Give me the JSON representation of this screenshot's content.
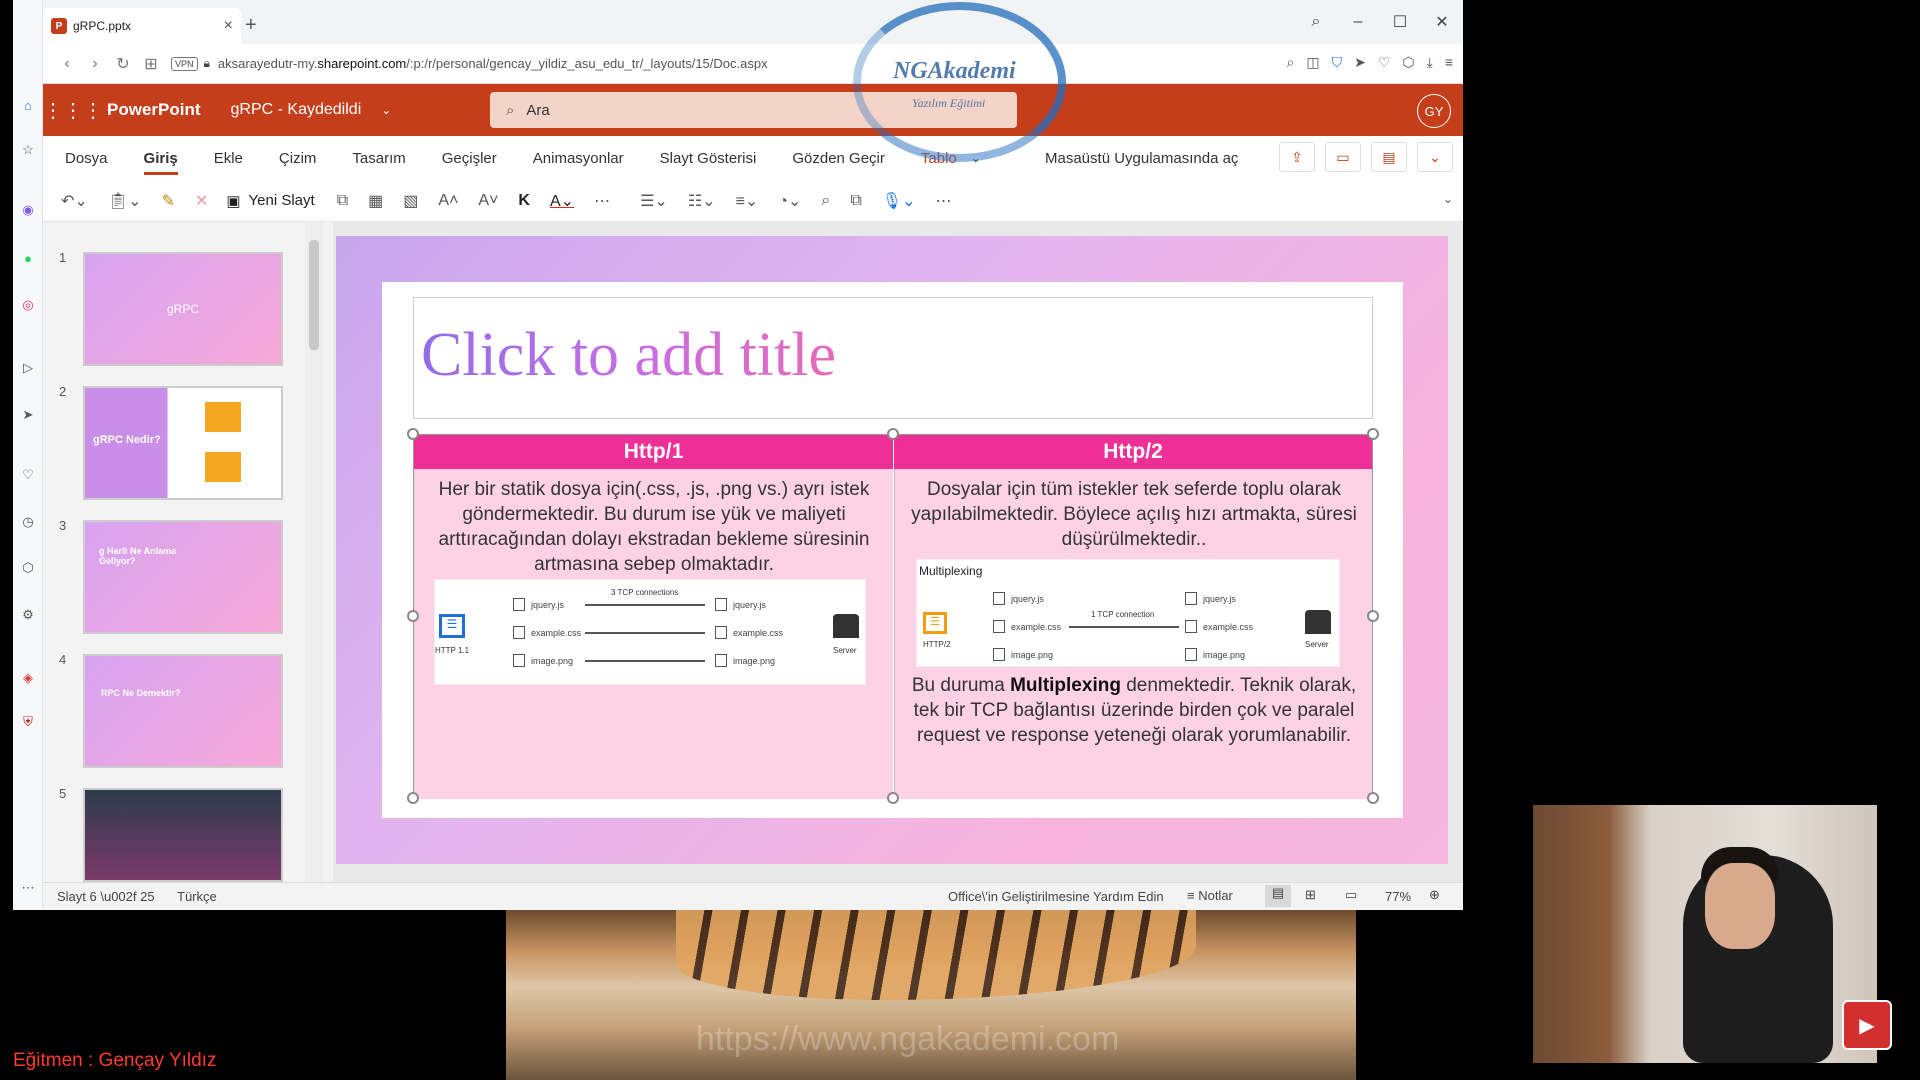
{
  "browser": {
    "tab_title": "gRPC.pptx",
    "url_prefix": "aksarayedutr-my.",
    "url_host": "sharepoint.com",
    "url_path": "/:p:/r/personal/gencay_yildiz_asu_edu_tr/_layouts/15/Doc.aspx",
    "vpn": "VPN"
  },
  "watermark": {
    "title": "NGAkademi",
    "subtitle": "Yazılım Eğitimi"
  },
  "ppt": {
    "app": "PowerPoint",
    "doc": "gRPC - Kaydedildi",
    "search_placeholder": "Ara",
    "avatar": "GY",
    "tabs": [
      "Dosya",
      "Giriş",
      "Ekle",
      "Çizim",
      "Tasarım",
      "Geçişler",
      "Animasyonlar",
      "Slayt Gösterisi",
      "Gözden Geçir",
      "Tablo"
    ],
    "desktop": "Masaüstü Uygulamasında aç",
    "new_slide": "Yeni Slayt"
  },
  "thumbnails": [
    {
      "num": "1",
      "text": "gRPC"
    },
    {
      "num": "2",
      "text": "gRPC Nedir?"
    },
    {
      "num": "3",
      "text": "g Harfi Ne Anlama Geliyor?"
    },
    {
      "num": "4",
      "text": "RPC Ne Demektir?"
    },
    {
      "num": "5",
      "text": ""
    }
  ],
  "slide": {
    "title": "Click to add title",
    "col1_header": "Http/1",
    "col2_header": "Http/2",
    "col1_text": "Her bir statik dosya için(.css, .js, .png vs.) ayrı istek göndermektedir. Bu durum ise yük ve maliyeti arttıracağından dolayı ekstradan bekleme süresinin artmasına sebep olmaktadır.",
    "col2_text": "Dosyalar için tüm istekler tek seferde toplu olarak yapılabilmektedir. Böylece açılış hızı artmakta, süresi düşürülmektedir..",
    "col2_text2_a": "Bu duruma ",
    "col2_text2_b": "Multiplexing",
    "col2_text2_c": " denmektedir. Teknik olarak, tek bir TCP bağlantısı üzerinde birden çok ve paralel request ve response yeteneği olarak yorumlanabilir.",
    "diag1": {
      "conn": "3 TCP connections",
      "files": [
        "jquery.js",
        "example.css",
        "image.png"
      ],
      "client": "HTTP 1.1",
      "server": "Server"
    },
    "diag2": {
      "title": "Multiplexing",
      "conn": "1 TCP connection",
      "files": [
        "jquery.js",
        "example.css",
        "image.png"
      ],
      "client": "HTTP/2",
      "server": "Server"
    }
  },
  "status": {
    "slide": "Slayt 6 \\u002f 25",
    "lang": "Türkçe",
    "help": "Office\\'in Geliştirilmesine Yardım Edin",
    "notes": "Notlar",
    "zoom": "77%"
  },
  "overlay": {
    "trainer": "Eğitmen : Gençay Yıldız",
    "site": "https://www.ngakademi.com"
  }
}
